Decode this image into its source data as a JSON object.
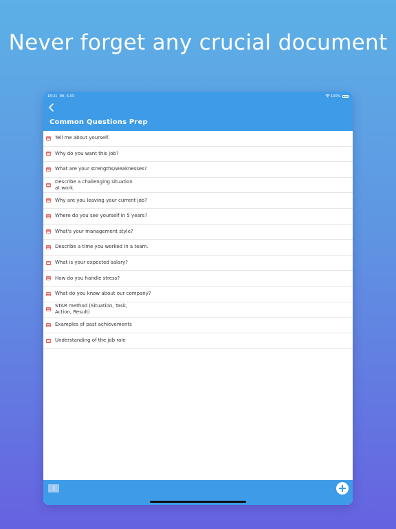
{
  "headline": "Never forget any crucial document",
  "status_bar": {
    "time": "18:31",
    "date": "Wt. 6.03",
    "battery": "100%"
  },
  "nav": {
    "back_icon": "chevron-left-icon",
    "title": "Common Questions Prep"
  },
  "items": [
    {
      "label": "Tell me about yourself."
    },
    {
      "label": "Why do you want this job?"
    },
    {
      "label": "What are your strengths/weaknesses?"
    },
    {
      "label": "Describe a challenging situation\nat work."
    },
    {
      "label": "Why are you leaving your current job?"
    },
    {
      "label": "Where do you see yourself in 5 years?"
    },
    {
      "label": "What's your management style?"
    },
    {
      "label": "Describe a time you worked in a team."
    },
    {
      "label": "What is your expected salary?"
    },
    {
      "label": "How do you handle stress?"
    },
    {
      "label": "What do you know about our company?"
    },
    {
      "label": "STAR method (Situation, Task,\nAction, Result)"
    },
    {
      "label": "Examples of past achievements"
    },
    {
      "label": "Understanding of the job role"
    }
  ],
  "toolbar": {
    "left_icon": "book-icon",
    "right_icon": "plus-circle-icon"
  },
  "colors": {
    "accent": "#3d9be8",
    "doc_icon": "#e46b6b"
  }
}
